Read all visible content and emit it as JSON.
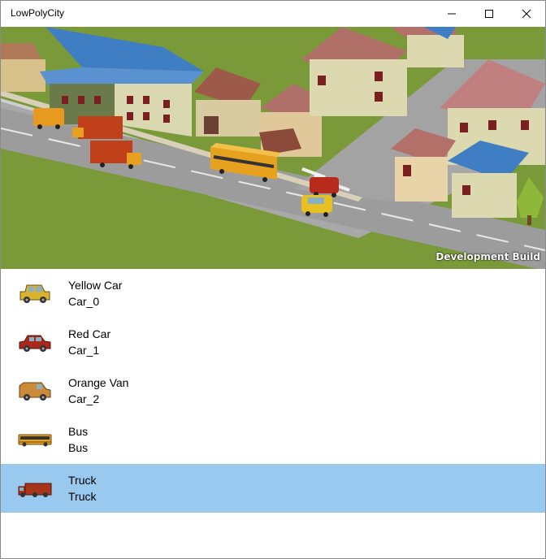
{
  "window": {
    "title": "LowPolyCity"
  },
  "scene": {
    "watermark": "Development Build"
  },
  "vehicles": [
    {
      "name": "Yellow Car",
      "id": "Car_0",
      "icon": "yellow-car-icon",
      "color": "#d9b230"
    },
    {
      "name": "Red Car",
      "id": "Car_1",
      "icon": "red-car-icon",
      "color": "#a8281c"
    },
    {
      "name": "Orange Van",
      "id": "Car_2",
      "icon": "orange-van-icon",
      "color": "#c98a3a"
    },
    {
      "name": "Bus",
      "id": "Bus",
      "icon": "bus-icon",
      "color": "#e6a21e"
    },
    {
      "name": "Truck",
      "id": "Truck",
      "icon": "truck-icon",
      "color": "#a8341c"
    }
  ],
  "selected_index": 4,
  "colors": {
    "selection": "#99c9ef"
  }
}
